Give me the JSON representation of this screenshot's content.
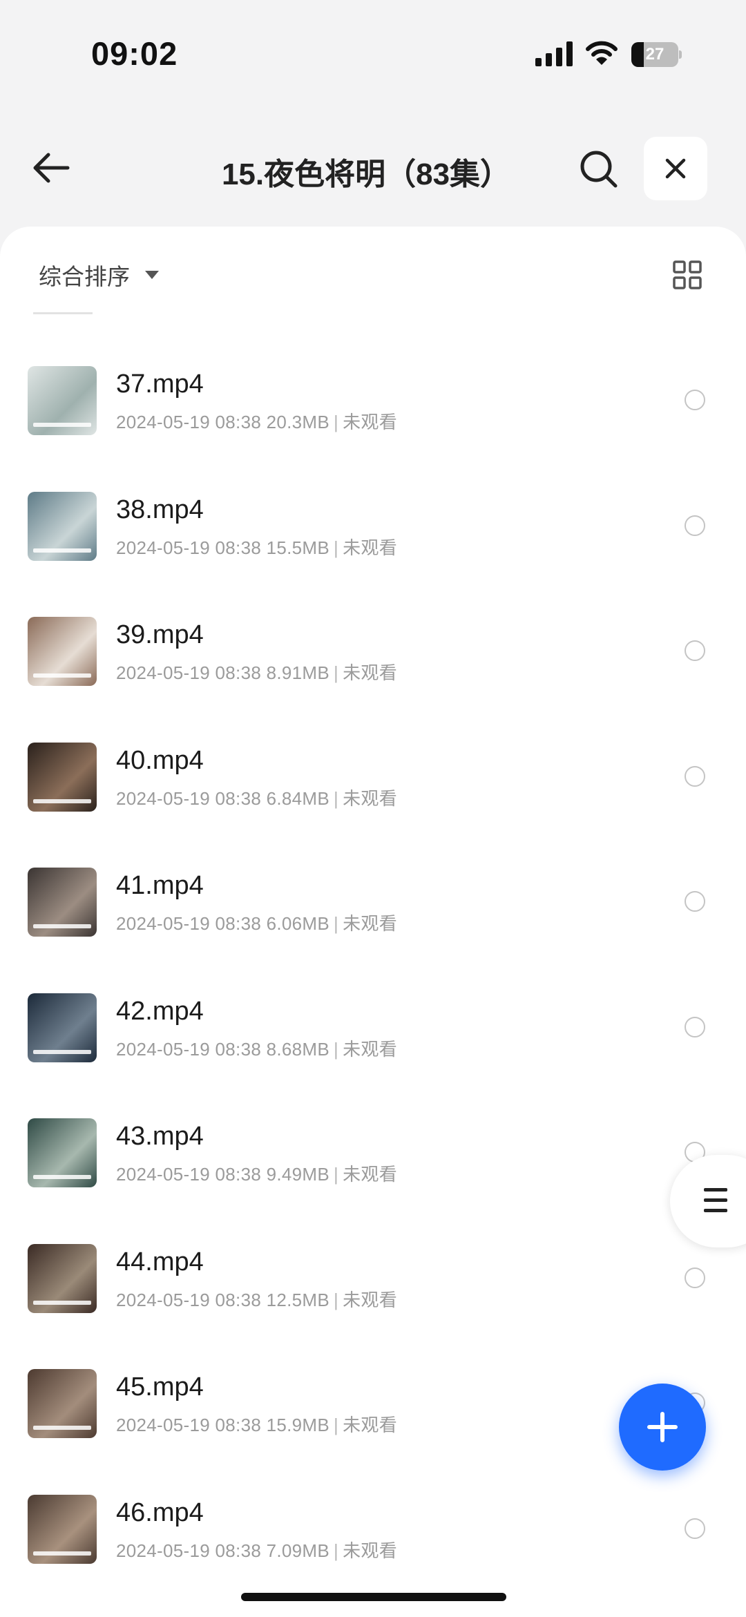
{
  "status_bar": {
    "time": "09:02",
    "battery_level": "27",
    "battery_fraction": 0.27,
    "icons": [
      "signal-icon",
      "wifi-icon",
      "battery-icon"
    ]
  },
  "header": {
    "title": "15.夜色将明（83集）",
    "icons": [
      "back-arrow-icon",
      "search-icon",
      "close-icon"
    ]
  },
  "toolbar": {
    "sort_label": "综合排序",
    "icons": [
      "caret-down-icon",
      "grid-view-icon"
    ]
  },
  "files": [
    {
      "name": "37.mp4",
      "date": "2024-05-19 08:38",
      "size": "20.3MB",
      "status": "未观看",
      "thumb_colors": [
        "#dfe5e4",
        "#9fb1ae"
      ]
    },
    {
      "name": "38.mp4",
      "date": "2024-05-19 08:38",
      "size": "15.5MB",
      "status": "未观看",
      "thumb_colors": [
        "#5e7b87",
        "#c9d5d6"
      ]
    },
    {
      "name": "39.mp4",
      "date": "2024-05-19 08:38",
      "size": "8.91MB",
      "status": "未观看",
      "thumb_colors": [
        "#8a6a57",
        "#e6ddd4"
      ]
    },
    {
      "name": "40.mp4",
      "date": "2024-05-19 08:38",
      "size": "6.84MB",
      "status": "未观看",
      "thumb_colors": [
        "#2a211c",
        "#8b6e59"
      ]
    },
    {
      "name": "41.mp4",
      "date": "2024-05-19 08:38",
      "size": "6.06MB",
      "status": "未观看",
      "thumb_colors": [
        "#3a3432",
        "#9c8d82"
      ]
    },
    {
      "name": "42.mp4",
      "date": "2024-05-19 08:38",
      "size": "8.68MB",
      "status": "未观看",
      "thumb_colors": [
        "#1c2a3a",
        "#6f7f8e"
      ]
    },
    {
      "name": "43.mp4",
      "date": "2024-05-19 08:38",
      "size": "9.49MB",
      "status": "未观看",
      "thumb_colors": [
        "#2f4a45",
        "#a7b8ae"
      ]
    },
    {
      "name": "44.mp4",
      "date": "2024-05-19 08:38",
      "size": "12.5MB",
      "status": "未观看",
      "thumb_colors": [
        "#3a2a24",
        "#9a8a78"
      ]
    },
    {
      "name": "45.mp4",
      "date": "2024-05-19 08:38",
      "size": "15.9MB",
      "status": "未观看",
      "thumb_colors": [
        "#4d3a30",
        "#a38d7c"
      ]
    },
    {
      "name": "46.mp4",
      "date": "2024-05-19 08:38",
      "size": "7.09MB",
      "status": "未观看",
      "thumb_colors": [
        "#4a3a31",
        "#a8917e"
      ]
    }
  ],
  "floating": {
    "side_menu_icon": "menu-lines-icon",
    "fab_icon": "plus-icon",
    "fab_color": "#1f6bff"
  }
}
